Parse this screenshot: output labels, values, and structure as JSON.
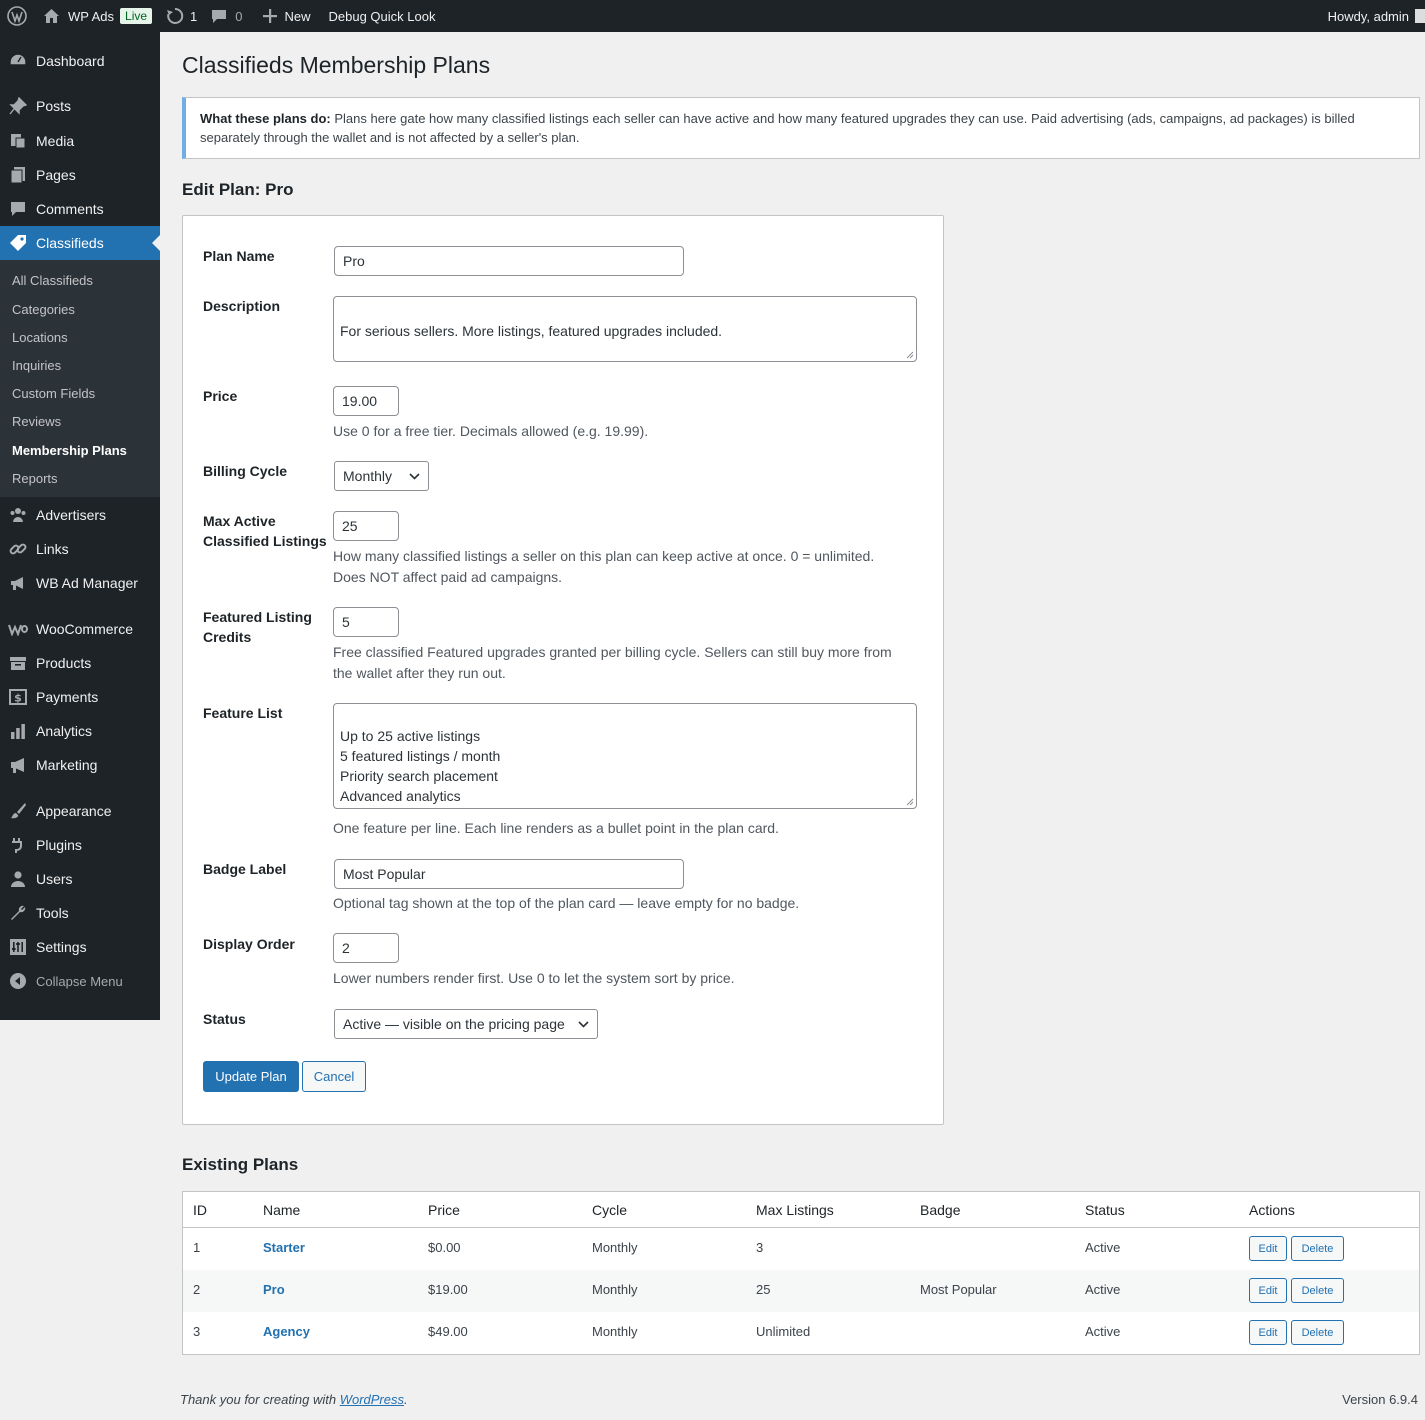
{
  "adminbar": {
    "site_name": "WP Ads",
    "live_badge": "Live",
    "updates_count": "1",
    "comments_count": "0",
    "new_label": "New",
    "debug_label": "Debug Quick Look",
    "howdy": "Howdy, admin"
  },
  "sidebar": {
    "items": {
      "dashboard": "Dashboard",
      "posts": "Posts",
      "media": "Media",
      "pages": "Pages",
      "comments": "Comments",
      "classifieds": "Classifieds",
      "advertisers": "Advertisers",
      "links": "Links",
      "wb_ad_manager": "WB Ad Manager",
      "woocommerce": "WooCommerce",
      "products": "Products",
      "payments": "Payments",
      "analytics": "Analytics",
      "marketing": "Marketing",
      "appearance": "Appearance",
      "plugins": "Plugins",
      "users": "Users",
      "tools": "Tools",
      "settings": "Settings",
      "collapse": "Collapse Menu"
    },
    "submenu": {
      "all_classifieds": "All Classifieds",
      "categories": "Categories",
      "locations": "Locations",
      "inquiries": "Inquiries",
      "custom_fields": "Custom Fields",
      "reviews": "Reviews",
      "membership_plans": "Membership Plans",
      "reports": "Reports"
    }
  },
  "page": {
    "title": "Classifieds Membership Plans",
    "notice_bold": "What these plans do:",
    "notice_text": "Plans here gate how many classified listings each seller can have active and how many featured upgrades they can use. Paid advertising (ads, campaigns, ad packages) is billed separately through the wallet and is not affected by a seller's plan.",
    "edit_title": "Edit Plan: Pro",
    "existing_title": "Existing Plans"
  },
  "form": {
    "plan_name": {
      "label": "Plan Name",
      "value": "Pro"
    },
    "description": {
      "label": "Description",
      "value": "For serious sellers. More listings, featured upgrades included."
    },
    "price": {
      "label": "Price",
      "value": "19.00",
      "help": "Use 0 for a free tier. Decimals allowed (e.g. 19.99)."
    },
    "billing_cycle": {
      "label": "Billing Cycle",
      "value": "Monthly"
    },
    "max_active": {
      "label_line1": "Max Active",
      "label_line2": "Classified Listings",
      "value": "25",
      "help_line1": "How many classified listings a seller on this plan can keep active at once. 0 = unlimited.",
      "help_line2": "Does NOT affect paid ad campaigns."
    },
    "featured_credits": {
      "label_line1": "Featured Listing",
      "label_line2": "Credits",
      "value": "5",
      "help_line1": "Free classified Featured upgrades granted per billing cycle. Sellers can still buy more from",
      "help_line2": "the wallet after they run out."
    },
    "feature_list": {
      "label": "Feature List",
      "value": "Up to 25 active listings\n5 featured listings / month\nPriority search placement\nAdvanced analytics",
      "help": "One feature per line. Each line renders as a bullet point in the plan card."
    },
    "badge_label": {
      "label": "Badge Label",
      "value": "Most Popular",
      "help": "Optional tag shown at the top of the plan card — leave empty for no badge."
    },
    "display_order": {
      "label": "Display Order",
      "value": "2",
      "help": "Lower numbers render first. Use 0 to let the system sort by price."
    },
    "status": {
      "label": "Status",
      "value": "Active — visible on the pricing page"
    },
    "update_button": "Update Plan",
    "cancel_button": "Cancel"
  },
  "table": {
    "headers": [
      "ID",
      "Name",
      "Price",
      "Cycle",
      "Max Listings",
      "Badge",
      "Status",
      "Actions"
    ],
    "rows": [
      {
        "id": "1",
        "name": "Starter",
        "price": "$0.00",
        "cycle": "Monthly",
        "max": "3",
        "badge": "",
        "status": "Active"
      },
      {
        "id": "2",
        "name": "Pro",
        "price": "$19.00",
        "cycle": "Monthly",
        "max": "25",
        "badge": "Most Popular",
        "status": "Active"
      },
      {
        "id": "3",
        "name": "Agency",
        "price": "$49.00",
        "cycle": "Monthly",
        "max": "Unlimited",
        "badge": "",
        "status": "Active"
      }
    ],
    "edit_label": "Edit",
    "delete_label": "Delete"
  },
  "footer": {
    "thanks_prefix": "Thank you for creating with",
    "thanks_link": "WordPress",
    "thanks_suffix": ".",
    "version": "Version 6.9.4"
  },
  "colors": {
    "accent": "#2271b1",
    "sidebar_bg": "#1d2327",
    "submenu_bg": "#2c3338",
    "notice_border": "#72aee6"
  }
}
